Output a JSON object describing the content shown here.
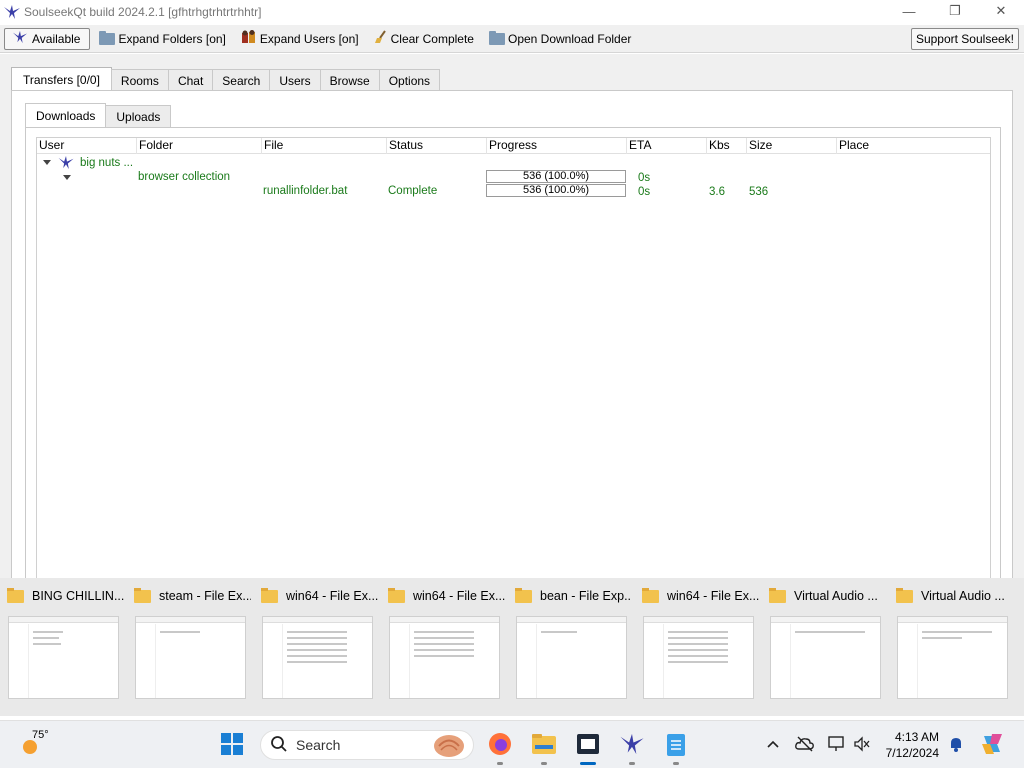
{
  "window": {
    "title": "SoulseekQt build 2024.2.1 [gfhtrhgtrhtrtrhhtr]",
    "controls": {
      "minimize": "—",
      "restore": "❐",
      "close": "✕"
    }
  },
  "toolbar": {
    "status_button": "Available",
    "expand_folders": "Expand Folders [on]",
    "expand_users": "Expand Users [on]",
    "clear_complete": "Clear Complete",
    "open_download_folder": "Open Download Folder",
    "support": "Support Soulseek!"
  },
  "tabs": [
    "Transfers [0/0]",
    "Rooms",
    "Chat",
    "Search",
    "Users",
    "Browse",
    "Options"
  ],
  "subtabs": [
    "Downloads",
    "Uploads"
  ],
  "columns": [
    "User",
    "Folder",
    "File",
    "Status",
    "Progress",
    "ETA",
    "Kbs",
    "Size",
    "Place"
  ],
  "transfers": {
    "user": "big nuts ...",
    "folder": "browser collection",
    "folder_progress": "536 (100.0%)",
    "folder_eta": "0s",
    "file": "runallinfolder.bat",
    "file_status": "Complete",
    "file_progress": "536 (100.0%)",
    "file_progress_fraction": 1.0,
    "file_eta": "0s",
    "file_kbs": "3.6",
    "file_size": "536"
  },
  "thumbnails": [
    {
      "label": "BING CHILLIN..."
    },
    {
      "label": "steam - File Ex..."
    },
    {
      "label": "win64 - File Ex..."
    },
    {
      "label": "win64 - File Ex..."
    },
    {
      "label": "bean - File Exp..."
    },
    {
      "label": "win64 - File Ex..."
    },
    {
      "label": "Virtual Audio ..."
    },
    {
      "label": "Virtual Audio ..."
    }
  ],
  "taskbar": {
    "weather_temp": "75°",
    "search_placeholder": "Search",
    "time": "4:13 AM",
    "date": "7/12/2024"
  },
  "colors": {
    "transfer_text": "#1a7a1a",
    "folder_yellow": "#f2c24d",
    "accent": "#0067c0"
  }
}
